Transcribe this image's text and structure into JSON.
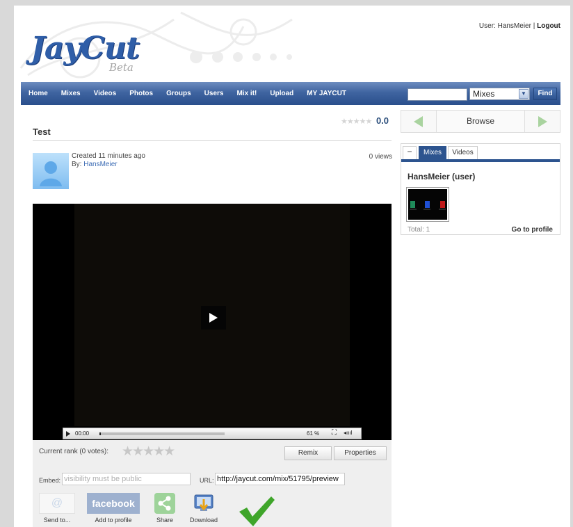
{
  "brand": {
    "logo_text": "JayCut",
    "logo_sub": "Beta"
  },
  "userbar": {
    "user_label": "User: HansMeier",
    "separator": "|",
    "logout": "Logout"
  },
  "nav": {
    "items": [
      "Home",
      "Mixes",
      "Videos",
      "Photos",
      "Groups",
      "Users",
      "Mix it!",
      "Upload",
      "MY JAYCUT"
    ],
    "search_value": "",
    "type_select_value": "Mixes",
    "find_label": "Find"
  },
  "mix": {
    "title": "Test",
    "rating_value": "0.0",
    "created": "Created 11 minutes ago",
    "by_label": "By:",
    "author": "HansMeier",
    "views": "0 views"
  },
  "player": {
    "time": "00:00",
    "percent": "61 %",
    "progress_fraction": 0
  },
  "actions": {
    "rank_label": "Current rank (0 votes):",
    "remix": "Remix",
    "properties": "Properties",
    "embed_label": "Embed:",
    "embed_value": "visibility must be public",
    "url_label": "URL:",
    "url_value": "http://jaycut.com/mix/51795/preview",
    "share": [
      {
        "label": "Send to...",
        "icon": "at-icon"
      },
      {
        "label": "Add to profile",
        "icon": "facebook-icon",
        "icon_text": "facebook"
      },
      {
        "label": "Share",
        "icon": "share-icon"
      },
      {
        "label": "Download",
        "icon": "download-icon"
      }
    ]
  },
  "sidebar": {
    "browse_label": "Browse",
    "tabs": [
      "−",
      "Mixes",
      "Videos"
    ],
    "active_tab": "Mixes",
    "user_heading": "HansMeier (user)",
    "total": "Total: 1",
    "profile_link": "Go to profile"
  },
  "colors": {
    "nav_bar": "#3f64a0",
    "logo_blue": "#2f5ea8",
    "check_green": "#3fa52a",
    "arrow_green": "#a9d39f"
  }
}
